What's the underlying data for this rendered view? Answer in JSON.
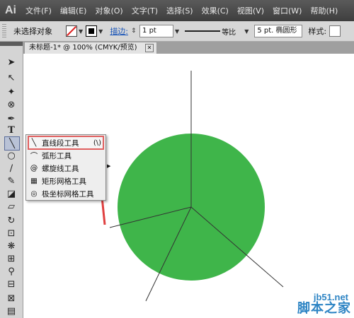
{
  "app": {
    "logo": "Ai"
  },
  "menu": [
    "文件(F)",
    "编辑(E)",
    "对象(O)",
    "文字(T)",
    "选择(S)",
    "效果(C)",
    "视图(V)",
    "窗口(W)",
    "帮助(H)"
  ],
  "control_bar": {
    "selection_status": "未选择对象",
    "stroke_label": "描边:",
    "stroke_weight": "1 pt",
    "profile": "等比",
    "brush": "5 pt. 椭圆形",
    "style_label": "样式:"
  },
  "document": {
    "tab_title": "未标题-1* @ 100% (CMYK/预览)",
    "circle_color": "#3fb54a"
  },
  "flyout": {
    "items": [
      {
        "label": "直线段工具",
        "shortcut": "(\\)",
        "icon": "line-segment-icon"
      },
      {
        "label": "弧形工具",
        "icon": "arc-icon"
      },
      {
        "label": "螺旋线工具",
        "icon": "spiral-icon"
      },
      {
        "label": "矩形网格工具",
        "icon": "rectangular-grid-icon"
      },
      {
        "label": "极坐标网格工具",
        "icon": "polar-grid-icon"
      }
    ],
    "highlight_color": "#e06060"
  },
  "watermark": {
    "site": "jb51.net",
    "name": "脚本之家"
  }
}
